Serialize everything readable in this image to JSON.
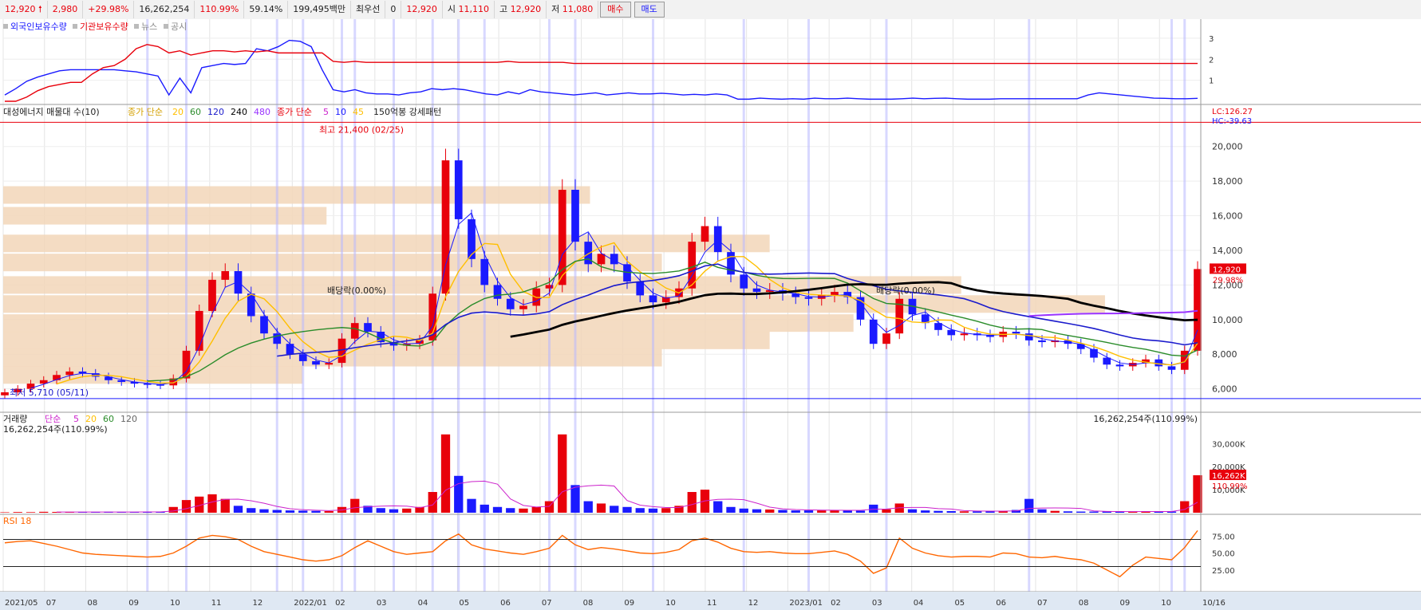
{
  "quote_bar": {
    "price": "12,920",
    "change": "2,980",
    "change_pct": "+29.98%",
    "volume": "16,262,254",
    "volume_ratio": "110.99%",
    "turnover_ratio": "59.14%",
    "amount": "199,495백만",
    "best_label": "최우선",
    "best_qty": "0",
    "best_price": "12,920",
    "open_label": "시",
    "open": "11,110",
    "high_label": "고",
    "high": "12,920",
    "low_label": "저",
    "low": "11,080",
    "buy_label": "매수",
    "sell_label": "매도"
  },
  "colors": {
    "up": "#e8000b",
    "down": "#1a1aff",
    "ma5": "#cc22cc",
    "ma10": "#1a1aff",
    "ma20": "#ffbf00",
    "ma60": "#2a8c2a",
    "ma120": "#1a1acc",
    "ma240": "#000000",
    "ma480": "#9933ff",
    "rsi": "#ff6600",
    "band": "#f2d6b8",
    "highlight": "#b8b8ff"
  },
  "chart_data": [
    {
      "type": "line",
      "title": "",
      "legend": [
        "외국인보유수량",
        "기관보유수량",
        "뉴스",
        "공시"
      ],
      "legend_colors": [
        "#1a1aff",
        "#e8000b",
        "#888888",
        "#888888"
      ],
      "yticks": [
        "3",
        "2",
        "1"
      ],
      "ylim": [
        0,
        3.3
      ],
      "series": [
        {
          "name": "외국인보유수량",
          "values": [
            0.3,
            0.6,
            0.95,
            1.15,
            1.3,
            1.45,
            1.5,
            1.5,
            1.5,
            1.5,
            1.5,
            1.45,
            1.4,
            1.3,
            1.2,
            0.3,
            1.1,
            0.4,
            1.6,
            1.7,
            1.8,
            1.75,
            1.8,
            2.5,
            2.4,
            2.6,
            2.9,
            2.85,
            2.6,
            1.5,
            0.55,
            0.45,
            0.55,
            0.4,
            0.35,
            0.35,
            0.3,
            0.4,
            0.45,
            0.6,
            0.55,
            0.6,
            0.55,
            0.45,
            0.35,
            0.3,
            0.45,
            0.35,
            0.55,
            0.45,
            0.4,
            0.35,
            0.3,
            0.35,
            0.4,
            0.3,
            0.35,
            0.4,
            0.35,
            0.35,
            0.38,
            0.35,
            0.3,
            0.33,
            0.3,
            0.35,
            0.3,
            0.1,
            0.1,
            0.15,
            0.12,
            0.1,
            0.12,
            0.1,
            0.15,
            0.12,
            0.12,
            0.15,
            0.12,
            0.1,
            0.1,
            0.1,
            0.12,
            0.15,
            0.12,
            0.14,
            0.15,
            0.12,
            0.1,
            0.1,
            0.1,
            0.12,
            0.12,
            0.12,
            0.12,
            0.12,
            0.12,
            0.12,
            0.12,
            0.3,
            0.4,
            0.35,
            0.3,
            0.25,
            0.2,
            0.15,
            0.14,
            0.12,
            0.12,
            0.14
          ]
        },
        {
          "name": "기관보유수량",
          "values": [
            0,
            0,
            0.2,
            0.5,
            0.7,
            0.8,
            0.9,
            0.9,
            1.3,
            1.6,
            1.7,
            2.0,
            2.5,
            2.7,
            2.6,
            2.3,
            2.4,
            2.2,
            2.3,
            2.4,
            2.4,
            2.35,
            2.4,
            2.35,
            2.4,
            2.3,
            2.3,
            2.3,
            2.3,
            2.3,
            1.9,
            1.85,
            1.9,
            1.85,
            1.85,
            1.85,
            1.85,
            1.85,
            1.85,
            1.85,
            1.85,
            1.85,
            1.85,
            1.85,
            1.85,
            1.85,
            1.9,
            1.85,
            1.85,
            1.85,
            1.85,
            1.85,
            1.8,
            1.8,
            1.8,
            1.8,
            1.8,
            1.8,
            1.8,
            1.8,
            1.8,
            1.8,
            1.8,
            1.8,
            1.8,
            1.8,
            1.8,
            1.8,
            1.8,
            1.8,
            1.8,
            1.8,
            1.8,
            1.8,
            1.8,
            1.8,
            1.8,
            1.8,
            1.8,
            1.8,
            1.8,
            1.8,
            1.8,
            1.8,
            1.8,
            1.8,
            1.8,
            1.8,
            1.8,
            1.8,
            1.8,
            1.8,
            1.8,
            1.8,
            1.8,
            1.8,
            1.8,
            1.8,
            1.8,
            1.8,
            1.8,
            1.8,
            1.8,
            1.8,
            1.8,
            1.8,
            1.8,
            1.8,
            1.8,
            1.8
          ]
        }
      ]
    },
    {
      "type": "candlestick",
      "title": "대성에너지 매물대 수(10)",
      "legend": {
        "ma_label": "종가 단순",
        "ma_periods": [
          "20",
          "60",
          "120",
          "240",
          "480"
        ],
        "ma2_label": "종가 단순",
        "ma2_periods": [
          "5",
          "10",
          "45"
        ],
        "pattern": "150억봉 강세패턴"
      },
      "months": [
        "2021/05",
        "07",
        "08",
        "09",
        "10",
        "11",
        "12",
        "2022/01",
        "02",
        "03",
        "04",
        "05",
        "06",
        "07",
        "08",
        "09",
        "10",
        "11",
        "12",
        "2023/01",
        "02",
        "03",
        "04",
        "05",
        "06",
        "07",
        "08",
        "09",
        "10",
        "10/16"
      ],
      "yticks": [
        "20,000",
        "18,000",
        "16,000",
        "14,000",
        "12,000",
        "10,000",
        "8,000",
        "6,000"
      ],
      "ylim": [
        5200,
        21600
      ],
      "close": [
        5800,
        6000,
        6300,
        6500,
        6800,
        7000,
        6900,
        6700,
        6500,
        6400,
        6300,
        6250,
        6200,
        6600,
        8200,
        10500,
        12300,
        12800,
        11500,
        10200,
        9200,
        8600,
        8000,
        7600,
        7400,
        7500,
        8900,
        9800,
        9300,
        8700,
        8500,
        8600,
        8800,
        11500,
        19200,
        15800,
        13500,
        12000,
        11200,
        10600,
        10800,
        11800,
        12000,
        17500,
        14500,
        13200,
        13800,
        13200,
        12200,
        11400,
        11000,
        11300,
        11800,
        14500,
        15400,
        13900,
        12600,
        11800,
        11600,
        11700,
        11500,
        11300,
        11200,
        11400,
        11600,
        11300,
        10000,
        8600,
        9200,
        11200,
        10300,
        9800,
        9400,
        9100,
        9200,
        9100,
        9000,
        9300,
        9200,
        8800,
        8700,
        8800,
        8600,
        8300,
        7800,
        7400,
        7300,
        7500,
        7700,
        7300,
        7100,
        8200,
        12920
      ],
      "max_label": "최고 21,400 (02/25)",
      "min_label": "최저 5,710 (05/11)",
      "dividend_label": "배당락(0.00%)",
      "last_price": "12,920",
      "last_pct": "29.98%",
      "lc_label": "LC:126.27",
      "hc_label": "HC:-39.63",
      "volume_profile": [
        {
          "price": 6800,
          "strength": 0.25
        },
        {
          "price": 7800,
          "strength": 0.55
        },
        {
          "price": 8800,
          "strength": 0.64
        },
        {
          "price": 9800,
          "strength": 0.71
        },
        {
          "price": 10900,
          "strength": 0.92
        },
        {
          "price": 12000,
          "strength": 0.8
        },
        {
          "price": 13300,
          "strength": 0.55
        },
        {
          "price": 14400,
          "strength": 0.64
        },
        {
          "price": 16000,
          "strength": 0.27
        },
        {
          "price": 17200,
          "strength": 0.49
        }
      ]
    },
    {
      "type": "bar",
      "title": "거래량",
      "legend": {
        "label": "단순",
        "periods": [
          "5",
          "20",
          "60",
          "120"
        ]
      },
      "value_label": "16,262,254주(110.99%)",
      "right_label": "16,262,254주(110.99%)",
      "yticks": [
        "30,000K",
        "20,000K",
        "10,000K"
      ],
      "ylim": [
        0,
        36000
      ],
      "values": [
        200,
        300,
        250,
        400,
        350,
        300,
        250,
        300,
        400,
        350,
        300,
        280,
        350,
        2500,
        5500,
        7000,
        8000,
        6000,
        3000,
        2000,
        1500,
        1200,
        1000,
        900,
        800,
        700,
        2500,
        6000,
        3000,
        2000,
        1500,
        1800,
        2500,
        9000,
        34000,
        16000,
        6000,
        3500,
        2500,
        2000,
        1800,
        2500,
        5000,
        34000,
        12000,
        5000,
        4000,
        3000,
        2500,
        2000,
        1800,
        2000,
        3000,
        9000,
        10000,
        5000,
        2500,
        1800,
        1500,
        1400,
        1200,
        1000,
        1000,
        1000,
        1200,
        1000,
        900,
        3500,
        1500,
        4000,
        1500,
        1000,
        800,
        700,
        600,
        600,
        700,
        800,
        1200,
        6000,
        1500,
        800,
        600,
        500,
        500,
        500,
        400,
        500,
        600,
        500,
        500,
        5000,
        16262
      ],
      "last_label": "16,262K",
      "last_pct": "110.99%"
    },
    {
      "type": "line",
      "title": "RSI 18",
      "yticks": [
        "75.00",
        "50.00",
        "25.00"
      ],
      "ylim": [
        0,
        100
      ],
      "levels": [
        70,
        30
      ],
      "values": [
        65,
        67,
        68,
        64,
        60,
        55,
        50,
        48,
        47,
        46,
        45,
        44,
        45,
        50,
        60,
        72,
        76,
        74,
        70,
        60,
        52,
        48,
        44,
        40,
        38,
        40,
        46,
        58,
        68,
        60,
        52,
        48,
        50,
        52,
        68,
        78,
        62,
        56,
        53,
        50,
        48,
        52,
        57,
        76,
        62,
        55,
        58,
        56,
        53,
        50,
        49,
        51,
        55,
        68,
        72,
        66,
        57,
        52,
        51,
        52,
        50,
        49,
        49,
        51,
        53,
        48,
        38,
        20,
        28,
        72,
        57,
        50,
        46,
        44,
        45,
        45,
        44,
        50,
        49,
        44,
        43,
        45,
        42,
        40,
        35,
        25,
        15,
        32,
        44,
        42,
        40,
        58,
        83
      ]
    }
  ]
}
